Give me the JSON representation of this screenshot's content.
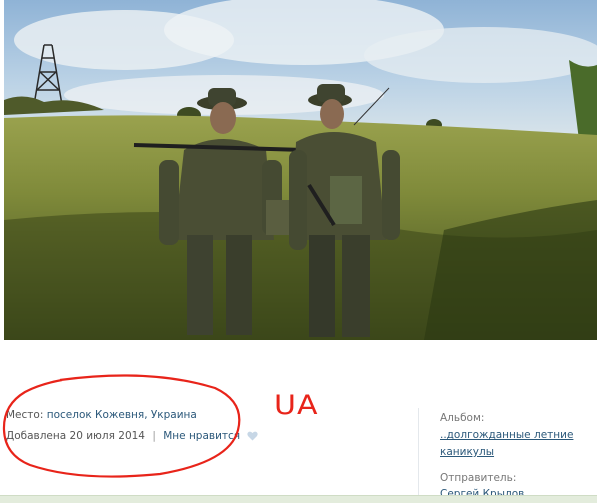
{
  "photo": {
    "description_icon": "photo-image"
  },
  "meta": {
    "place_label": "Место:",
    "place_value": "поселок Кожевня, Украина",
    "added_label": "Добавлена 20 июля 2014",
    "separator": "|",
    "like_label": "Мне нравится",
    "like_icon": "heart-icon"
  },
  "annotation": {
    "text": "UA",
    "color": "#e8241a"
  },
  "sidebar": {
    "album_label": "Альбом:",
    "album_name": "..долгожданные летние каникулы",
    "sender_label": "Отправитель:",
    "sender_name": "Сергей Крылов"
  },
  "colors": {
    "link": "#2b587a",
    "annotation": "#e8241a"
  }
}
